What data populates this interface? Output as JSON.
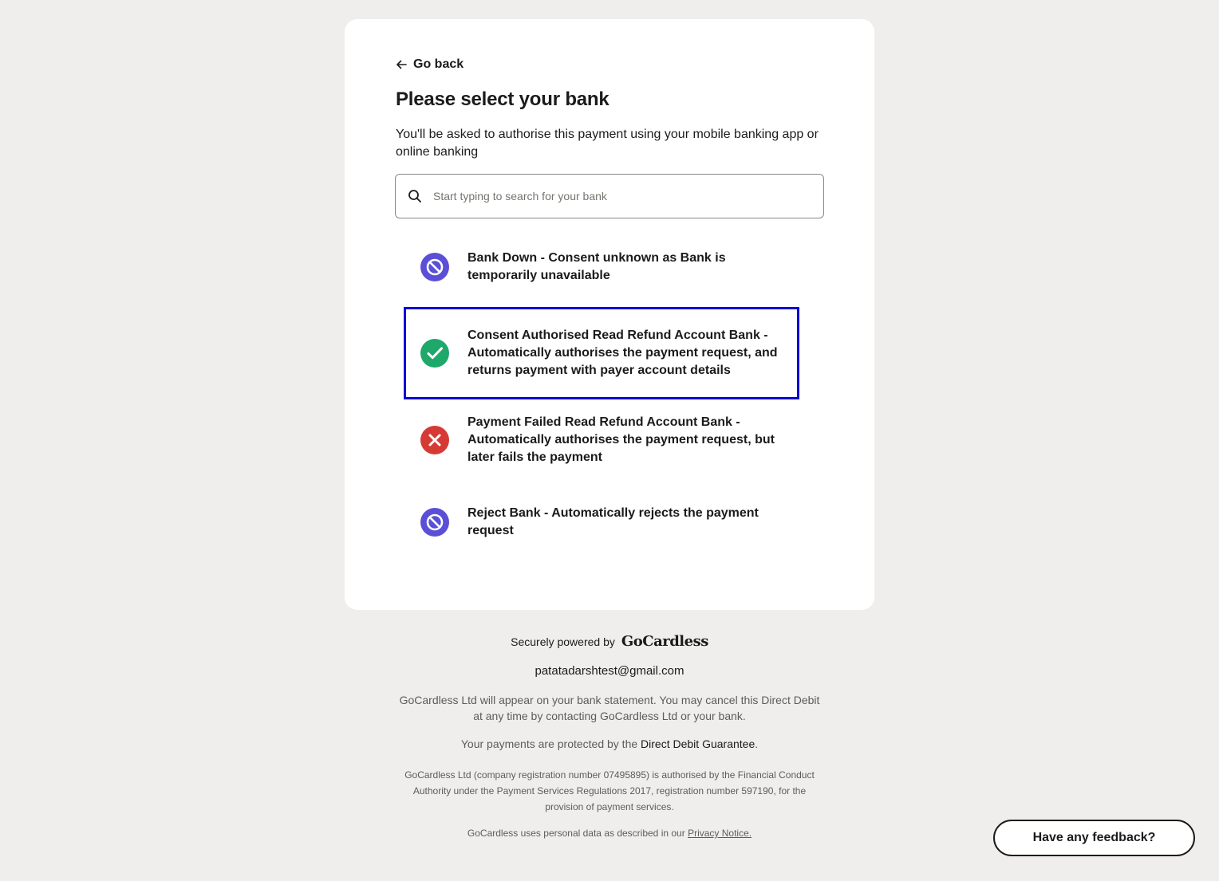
{
  "nav": {
    "back_label": "Go back"
  },
  "page": {
    "title": "Please select your bank",
    "subtitle": "You'll be asked to authorise this payment using your mobile banking app or online banking"
  },
  "search": {
    "placeholder": "Start typing to search for your bank",
    "value": ""
  },
  "banks": [
    {
      "label": "Bank Down - Consent unknown as Bank is temporarily unavailable",
      "icon": "blocked-icon",
      "color": "#5a4fd6"
    },
    {
      "label": "Consent Authorised Read Refund Account Bank - Automatically authorises the payment request, and returns payment with payer account details",
      "icon": "check-icon",
      "color": "#1ea86a",
      "selected": true
    },
    {
      "label": "Payment Failed Read Refund Account Bank - Automatically authorises the payment request, but later fails the payment",
      "icon": "error-x-icon",
      "color": "#d63a35"
    },
    {
      "label": "Reject Bank - Automatically rejects the payment request",
      "icon": "blocked-icon",
      "color": "#5a4fd6"
    }
  ],
  "footer": {
    "powered_by": "Securely powered by",
    "brand": "GoCardless",
    "email": "patatadarshtest@gmail.com",
    "statement_notice": "GoCardless Ltd will appear on your bank statement. You may cancel this Direct Debit at any time by contacting GoCardless Ltd or your bank.",
    "protected_prefix": "Your payments are protected by the",
    "guarantee_link": "Direct Debit Guarantee",
    "protected_suffix": ".",
    "legal": "GoCardless Ltd (company registration number 07495895) is authorised by the Financial Conduct Authority under the Payment Services Regulations 2017, registration number 597190, for the provision of payment services.",
    "privacy_prefix": "GoCardless uses personal data as described in our",
    "privacy_link": "Privacy Notice."
  },
  "feedback_button": "Have any feedback?",
  "colors": {
    "selection_border": "#0a00d6",
    "background": "#efeeec"
  }
}
